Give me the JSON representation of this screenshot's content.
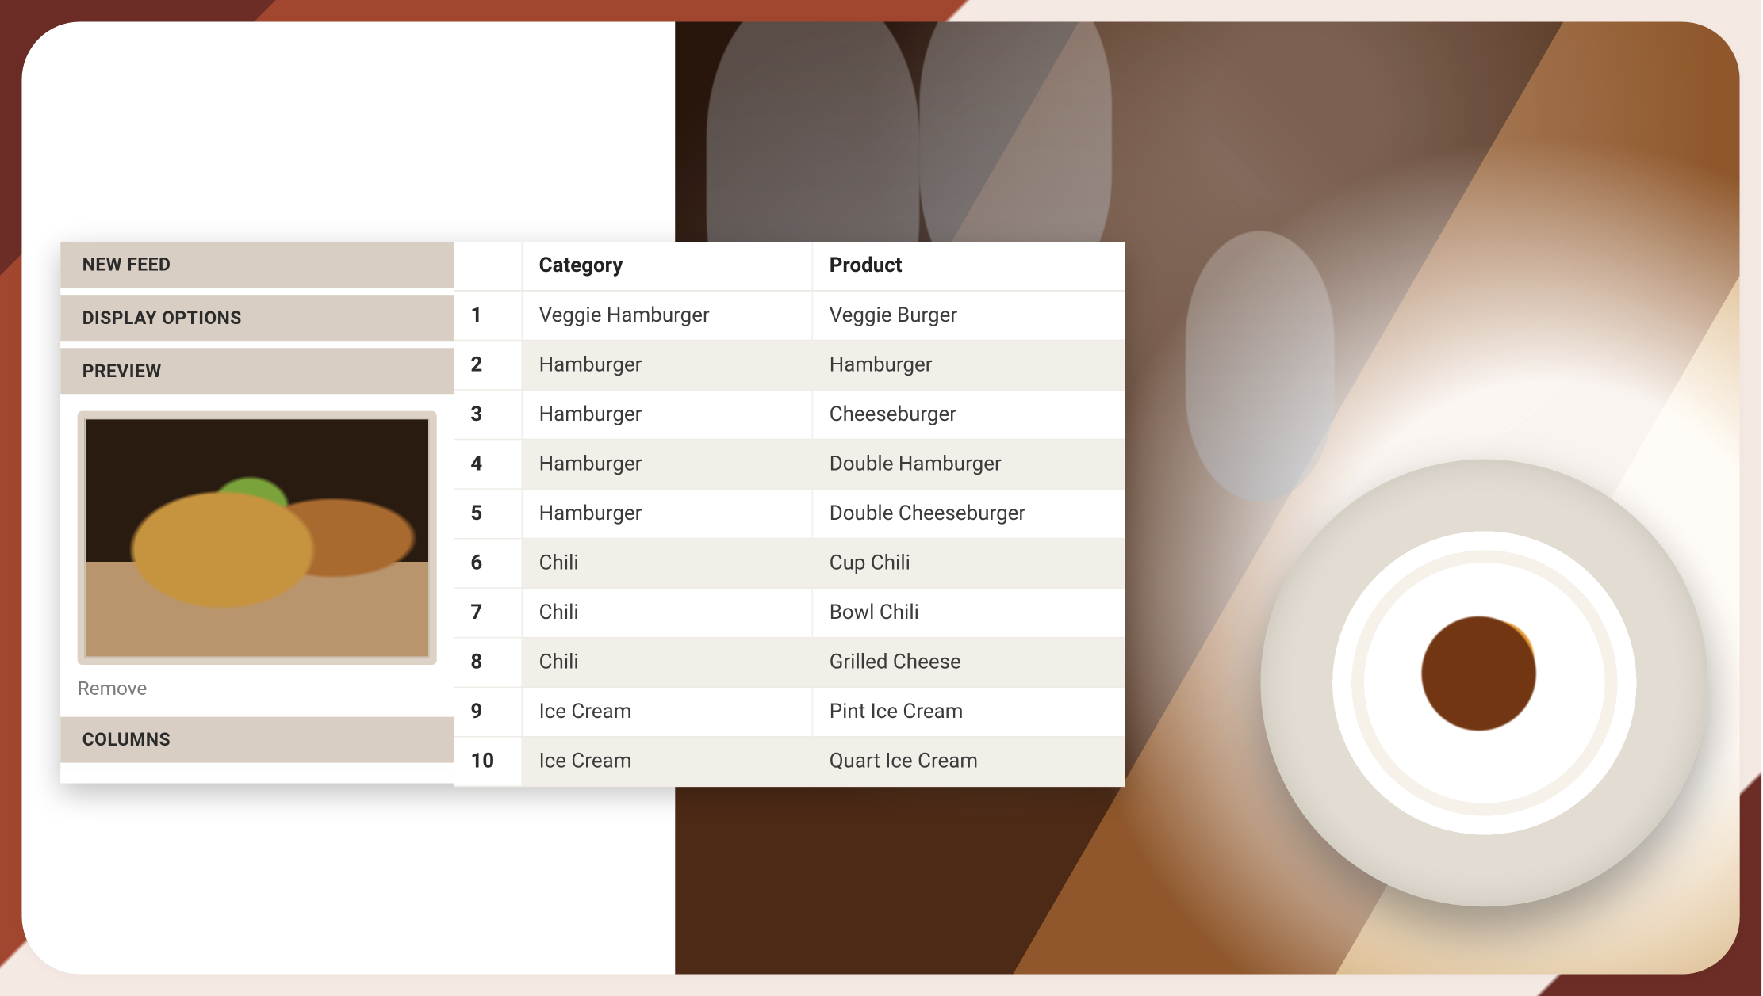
{
  "sidebar": {
    "items": [
      {
        "label": "NEW FEED"
      },
      {
        "label": "DISPLAY OPTIONS"
      },
      {
        "label": "PREVIEW"
      },
      {
        "label": "COLUMNS"
      }
    ],
    "preview": {
      "remove_label": "Remove"
    }
  },
  "table": {
    "headers": {
      "index": "",
      "category": "Category",
      "product": "Product"
    },
    "rows": [
      {
        "n": "1",
        "category": "Veggie Hamburger",
        "product": "Veggie Burger"
      },
      {
        "n": "2",
        "category": "Hamburger",
        "product": "Hamburger"
      },
      {
        "n": "3",
        "category": "Hamburger",
        "product": "Cheeseburger"
      },
      {
        "n": "4",
        "category": "Hamburger",
        "product": "Double Hamburger"
      },
      {
        "n": "5",
        "category": "Hamburger",
        "product": "Double Cheeseburger"
      },
      {
        "n": "6",
        "category": "Chili",
        "product": "Cup Chili"
      },
      {
        "n": "7",
        "category": "Chili",
        "product": "Bowl Chili"
      },
      {
        "n": "8",
        "category": "Chili",
        "product": "Grilled Cheese"
      },
      {
        "n": "9",
        "category": "Ice Cream",
        "product": "Pint Ice Cream"
      },
      {
        "n": "10",
        "category": "Ice Cream",
        "product": "Quart Ice Cream"
      }
    ]
  }
}
